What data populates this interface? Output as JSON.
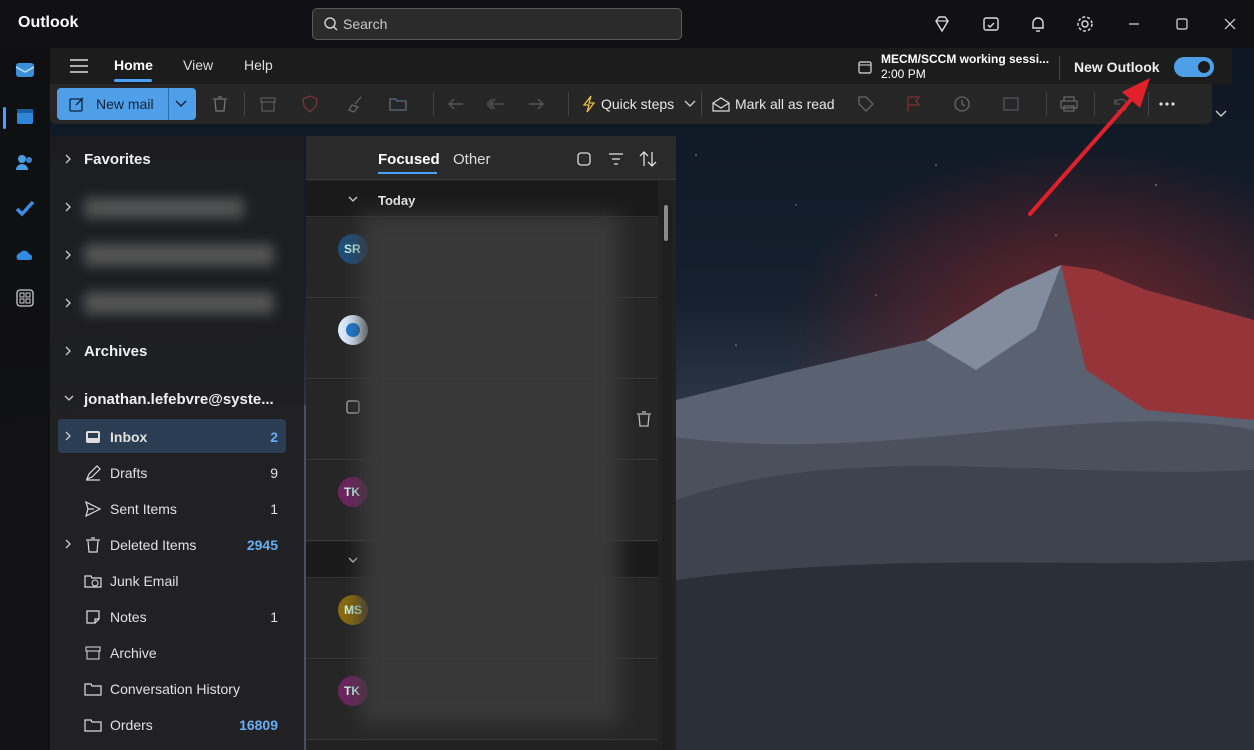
{
  "app": {
    "title": "Outlook"
  },
  "search": {
    "placeholder": "Search"
  },
  "ribbon": {
    "tabs": [
      "Home",
      "View",
      "Help"
    ],
    "meeting_title": "MECM/SCCM working sessi...",
    "meeting_time": "2:00 PM",
    "new_outlook_label": "New Outlook",
    "new_outlook_enabled": true,
    "new_mail_label": "New mail",
    "quick_steps_label": "Quick steps",
    "mark_all_read_label": "Mark all as read"
  },
  "folders": {
    "favorites": "Favorites",
    "archives": "Archives",
    "account": "jonathan.lefebvre@syste...",
    "items": [
      {
        "label": "Inbox",
        "count": "2"
      },
      {
        "label": "Drafts",
        "count": "9"
      },
      {
        "label": "Sent Items",
        "count": "1"
      },
      {
        "label": "Deleted Items",
        "count": "2945"
      },
      {
        "label": "Junk Email",
        "count": ""
      },
      {
        "label": "Notes",
        "count": "1"
      },
      {
        "label": "Archive",
        "count": ""
      },
      {
        "label": "Conversation History",
        "count": ""
      },
      {
        "label": "Orders",
        "count": "16809"
      }
    ]
  },
  "message_list": {
    "tab_focused": "Focused",
    "tab_other": "Other",
    "group_today": "Today",
    "avatars": [
      "SR",
      "",
      "",
      "TK",
      "MS",
      "TK"
    ]
  },
  "colors": {
    "accent": "#4f9fe8",
    "arrow": "#e0202a"
  }
}
